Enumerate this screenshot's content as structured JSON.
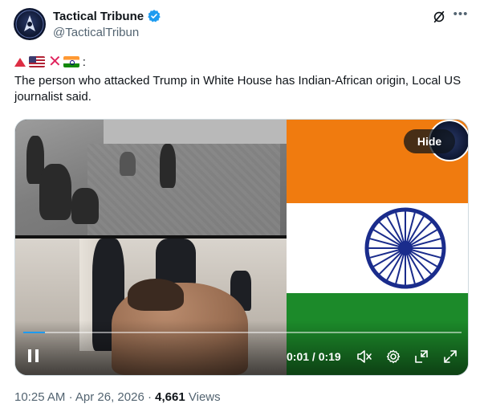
{
  "author": {
    "display_name": "Tactical Tribune",
    "handle": "@TacticalTribun",
    "verified": true
  },
  "tweet": {
    "emoji_line": [
      {
        "name": "red-triangle-icon"
      },
      {
        "name": "us-flag-icon"
      },
      {
        "name": "cross-mark-icon",
        "glyph": "✕"
      },
      {
        "name": "india-flag-icon"
      }
    ],
    "emoji_suffix": ":",
    "text": "The person who attacked Trump in White House has Indian-African origin, Local US journalist said."
  },
  "media": {
    "hide_label": "Hide",
    "time_display": "0:01 / 0:19",
    "progress": 0.05,
    "colors": {
      "saffron": "#f07b0f",
      "white": "#ffffff",
      "green": "#1c8a2a",
      "chakra": "#1a2c8c"
    }
  },
  "meta": {
    "time": "10:25 AM",
    "separator": "·",
    "date": "Apr 26, 2026",
    "views_count": "4,661",
    "views_label": "Views"
  },
  "icons": {
    "grok": "grok-icon",
    "more": "more-icon",
    "play": "pause-icon",
    "mute": "mute-icon",
    "settings": "settings-icon",
    "pip": "picture-in-picture-icon",
    "fullscreen": "fullscreen-icon"
  }
}
